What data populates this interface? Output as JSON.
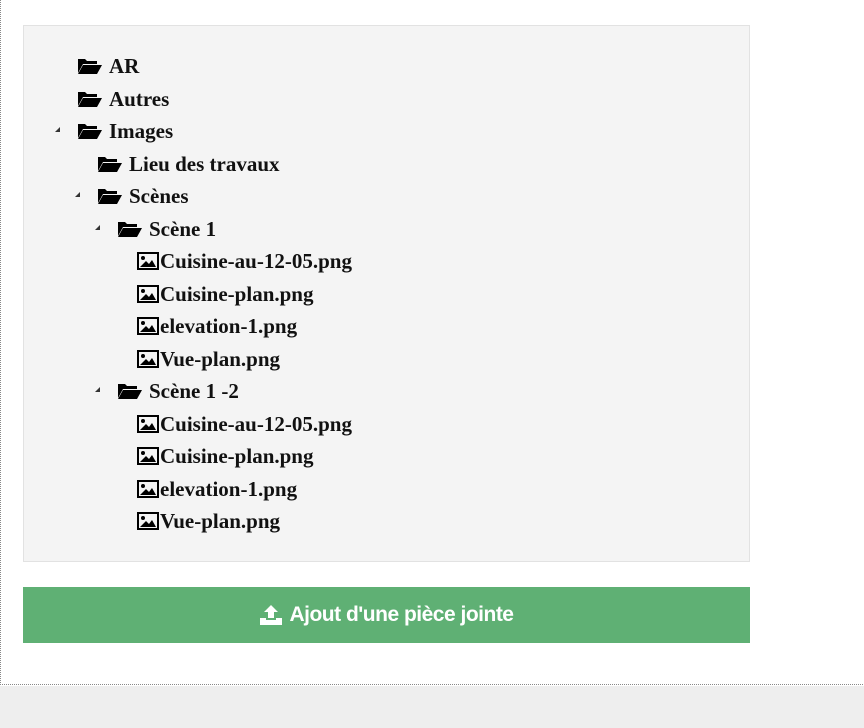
{
  "tree": {
    "items": [
      {
        "label": "AR",
        "type": "folder",
        "expanded": false
      },
      {
        "label": "Autres",
        "type": "folder",
        "expanded": false
      },
      {
        "label": "Images",
        "type": "folder",
        "expanded": true
      },
      {
        "label": "Lieu des travaux",
        "type": "folder",
        "expanded": false
      },
      {
        "label": "Scènes",
        "type": "folder",
        "expanded": true
      },
      {
        "label": "Scène 1",
        "type": "folder",
        "expanded": true
      },
      {
        "label": "Cuisine-au-12-05.png",
        "type": "image"
      },
      {
        "label": "Cuisine-plan.png",
        "type": "image"
      },
      {
        "label": "elevation-1.png",
        "type": "image"
      },
      {
        "label": "Vue-plan.png",
        "type": "image"
      },
      {
        "label": "Scène 1 -2",
        "type": "folder",
        "expanded": true
      },
      {
        "label": "Cuisine-au-12-05.png",
        "type": "image"
      },
      {
        "label": "Cuisine-plan.png",
        "type": "image"
      },
      {
        "label": "elevation-1.png",
        "type": "image"
      },
      {
        "label": "Vue-plan.png",
        "type": "image"
      }
    ]
  },
  "upload": {
    "label": "Ajout d'une pièce jointe",
    "icon": "upload-icon",
    "color": "#5fb074"
  },
  "icons": {
    "folder": "folder-open-icon",
    "image": "image-file-icon",
    "toggle": "caret-expanded-icon"
  }
}
